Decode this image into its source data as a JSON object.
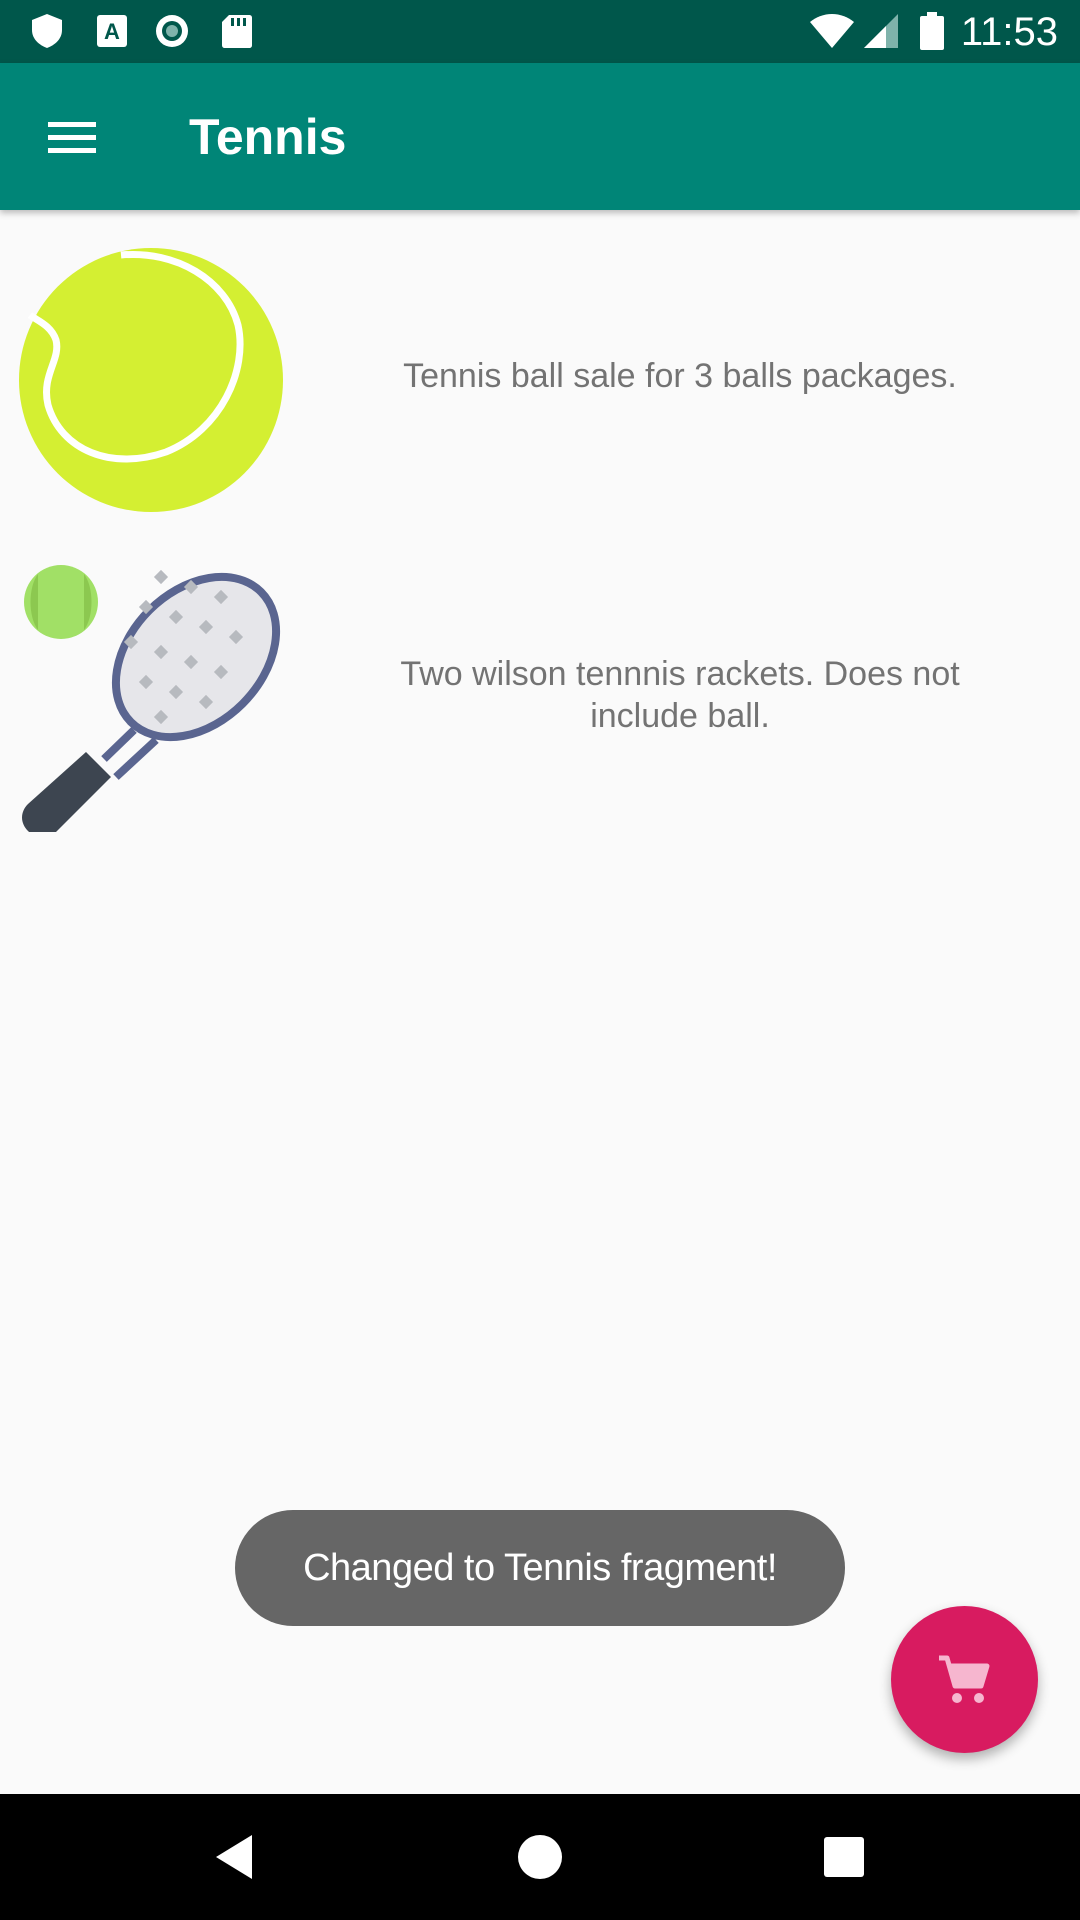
{
  "status_bar": {
    "time": "11:53",
    "icons": [
      "shield-icon",
      "font-a-icon",
      "circle-record-icon",
      "sd-card-icon",
      "wifi-icon",
      "signal-icon",
      "battery-icon"
    ]
  },
  "app_bar": {
    "title": "Tennis",
    "menu_icon": "hamburger-menu-icon"
  },
  "products": [
    {
      "image_icon": "tennis-ball-icon",
      "description": "Tennis ball sale for 3 balls packages."
    },
    {
      "image_icon": "tennis-racket-icon",
      "description": "Two wilson tennnis rackets. Does not include ball."
    }
  ],
  "toast": {
    "message": "Changed to Tennis fragment!"
  },
  "fab": {
    "icon": "shopping-cart-icon",
    "color": "#d81b60"
  },
  "nav_bar": {
    "buttons": [
      "back-icon",
      "home-icon",
      "recents-icon"
    ]
  },
  "colors": {
    "status_bar": "#00574b",
    "app_bar": "#008577",
    "accent": "#d81b60",
    "toast": "#666666"
  }
}
